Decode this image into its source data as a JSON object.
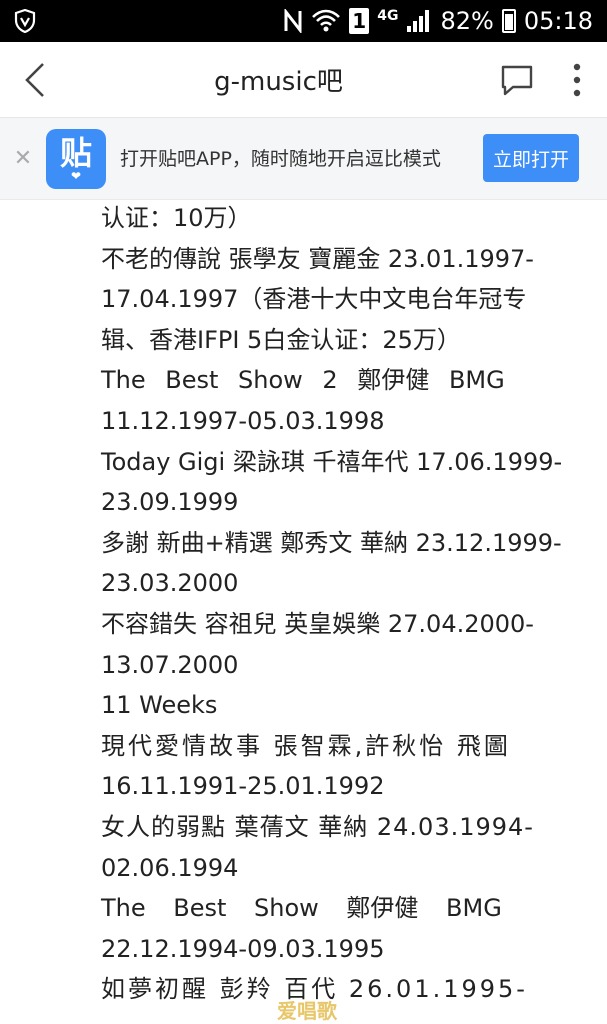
{
  "status_bar": {
    "icons": [
      "shield-v-icon",
      "nfc-icon",
      "wifi-icon",
      "sim-1-icon",
      "4g-icon",
      "signal-icon",
      "battery-icon"
    ],
    "sim_label": "1",
    "network_label": "4G",
    "battery": "82%",
    "time": "05:18"
  },
  "navbar": {
    "title": "g-music吧",
    "icons": [
      "back-chevron-icon",
      "comment-icon",
      "more-vertical-icon"
    ]
  },
  "banner": {
    "close": "✕",
    "logo_glyph": "贴",
    "text": "打开贴吧APP，随时随地开启逗比模式",
    "open_label": "立即打开",
    "accent": "#3e8ef7"
  },
  "content": {
    "lines": [
      "认证：10万）",
      "不老的傳說 張學友 寶麗金 23.01.1997-",
      "17.04.1997（香港十大中文电台年冠专",
      "辑、香港IFPI 5白金认证：25万）",
      "The Best Show 2 鄭伊健 BMG",
      "11.12.1997-05.03.1998",
      "Today Gigi 梁詠琪 千禧年代 17.06.1999-",
      "23.09.1999",
      "多謝 新曲+精選 鄭秀文 華納 23.12.1999-",
      "23.03.2000",
      "不容錯失 容祖兒 英皇娛樂 27.04.2000-",
      "13.07.2000",
      "11 Weeks",
      "現代愛情故事 張智霖,許秋怡 飛圖",
      "16.11.1991-25.01.1992",
      "女人的弱點 葉蒨文 華納 24.03.1994-",
      "02.06.1994",
      "The Best Show 鄭伊健 BMG",
      "22.12.1994-09.03.1995",
      "如夢初醒 彭羚 百代 26.01.1995-"
    ]
  },
  "watermark": "爱唱歌"
}
